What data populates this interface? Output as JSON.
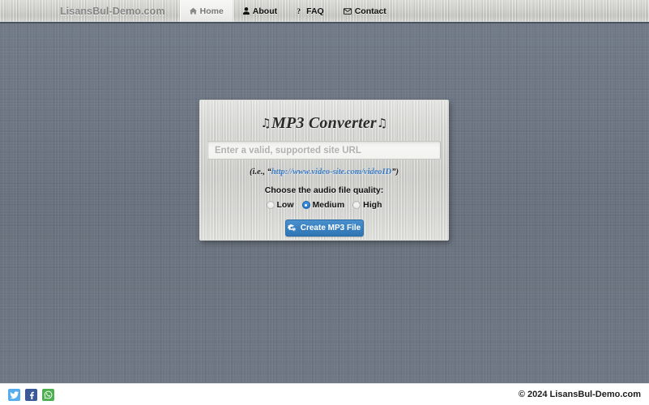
{
  "navbar": {
    "brand": "LisansBul-Demo.com",
    "items": [
      {
        "label": "Home",
        "icon": "home-icon",
        "active": true
      },
      {
        "label": "About",
        "icon": "user-icon",
        "active": false
      },
      {
        "label": "FAQ",
        "icon": "question-mark-icon",
        "active": false
      },
      {
        "label": "Contact",
        "icon": "envelope-icon",
        "active": false
      }
    ]
  },
  "card": {
    "title": "MP3 Converter",
    "title_note_left": "♫",
    "title_note_right": "♫",
    "url_input": {
      "value": "",
      "placeholder": "Enter a valid, supported site URL"
    },
    "hint": {
      "prefix": "(i.e., “",
      "link": "http://www.video-site.com/videoID",
      "suffix": "”)"
    },
    "quality": {
      "label": "Choose the audio file quality:",
      "options": [
        {
          "label": "Low",
          "selected": false
        },
        {
          "label": "Medium",
          "selected": true
        },
        {
          "label": "High",
          "selected": false
        }
      ]
    },
    "submit": {
      "label": "Create MP3 File",
      "icon": "cogs-icon"
    }
  },
  "footer": {
    "social": [
      {
        "name": "twitter-icon",
        "color": "#55acee"
      },
      {
        "name": "facebook-icon",
        "color": "#3b5998"
      },
      {
        "name": "whatsapp-icon",
        "color": "#4caf50"
      }
    ],
    "copyright": "© 2024 LisansBul-Demo.com"
  },
  "colors": {
    "background": "#6c7584",
    "accent_blue": "#3c84c2",
    "link_blue": "#3f7fc6",
    "navbar_metal": "#cbcbc7",
    "card_metal": "#d0d0cd"
  }
}
